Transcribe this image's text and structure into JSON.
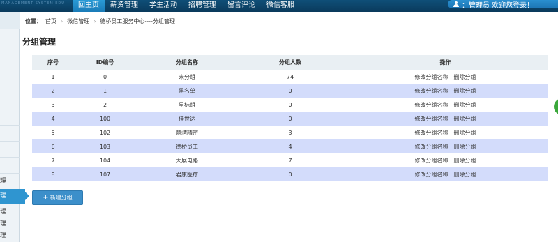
{
  "header": {
    "logo_text": "MANAGEMENT SYSTEM EDU",
    "nav": [
      {
        "label": "回主页",
        "active": true
      },
      {
        "label": "薪资管理",
        "active": false
      },
      {
        "label": "学生活动",
        "active": false
      },
      {
        "label": "招聘管理",
        "active": false
      },
      {
        "label": "留言评论",
        "active": false
      },
      {
        "label": "微信客服",
        "active": false
      }
    ],
    "user_text": "：管理员  欢迎您登录！"
  },
  "sidebar": {
    "items": [
      {
        "label": "理"
      },
      {
        "label": "理"
      },
      {
        "label": "理"
      },
      {
        "label": "理"
      },
      {
        "label": "理"
      }
    ],
    "active_label": "理"
  },
  "breadcrumb": {
    "label": "位置：",
    "items": [
      "首页",
      "微信管理",
      "德桥员工服务中心----分组管理"
    ]
  },
  "page": {
    "title": "分组管理"
  },
  "table": {
    "headers": [
      "序号",
      "ID编号",
      "分组名称",
      "分组人数",
      "操作"
    ],
    "rows": [
      {
        "no": "1",
        "id": "0",
        "name": "未分组",
        "count": "74"
      },
      {
        "no": "2",
        "id": "1",
        "name": "黑名单",
        "count": "0"
      },
      {
        "no": "3",
        "id": "2",
        "name": "星标组",
        "count": "0"
      },
      {
        "no": "4",
        "id": "100",
        "name": "佳世达",
        "count": "0"
      },
      {
        "no": "5",
        "id": "102",
        "name": "鼎骋精密",
        "count": "3"
      },
      {
        "no": "6",
        "id": "103",
        "name": "德桥员工",
        "count": "4"
      },
      {
        "no": "7",
        "id": "104",
        "name": "大展电路",
        "count": "7"
      },
      {
        "no": "8",
        "id": "107",
        "name": "君康医疗",
        "count": "0"
      }
    ],
    "rename_label": "修改分组名称",
    "delete_label": "删除分组"
  },
  "actions": {
    "new_group_label": "新建分组"
  },
  "colors": {
    "topbar": "#0a3a5c",
    "nav_active": "#2a9bd6",
    "row_alt": "#d3dcfb",
    "button": "#3c8fca",
    "accent_green": "#3aa83a"
  }
}
